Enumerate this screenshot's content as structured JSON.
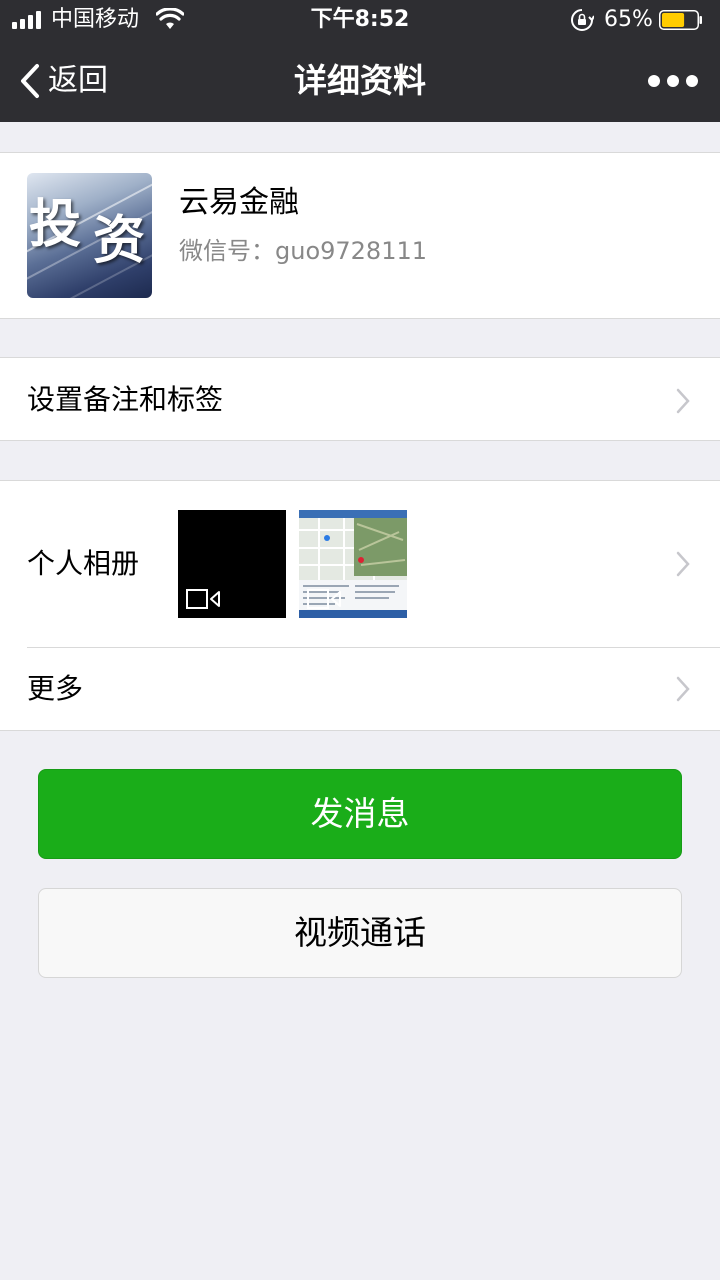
{
  "status_bar": {
    "carrier": "中国移动",
    "time": "下午8:52",
    "battery_percent": "65%",
    "battery_level": 0.65,
    "battery_color": "#ffcc00",
    "signal_bars": 4,
    "icons": [
      "signal-icon",
      "wifi-icon",
      "rotation-lock-icon",
      "battery-icon"
    ]
  },
  "nav": {
    "back_label": "返回",
    "title": "详细资料",
    "more_icon": "more-dots-icon"
  },
  "profile": {
    "avatar_text": [
      "投",
      "资"
    ],
    "name": "云易金融",
    "wechat_id": "微信号：guo9728111"
  },
  "rows": {
    "remark_label": "设置备注和标签",
    "album_label": "个人相册",
    "more_label": "更多"
  },
  "album": {
    "thumbnails": [
      {
        "type": "video",
        "icon": "video-camera-icon"
      },
      {
        "type": "video",
        "icon": "video-camera-icon"
      }
    ]
  },
  "buttons": {
    "send_message": "发消息",
    "video_call": "视频通话"
  },
  "colors": {
    "nav_bg": "#2e2e32",
    "page_bg": "#efeff4",
    "accent_green": "#1aad19"
  }
}
